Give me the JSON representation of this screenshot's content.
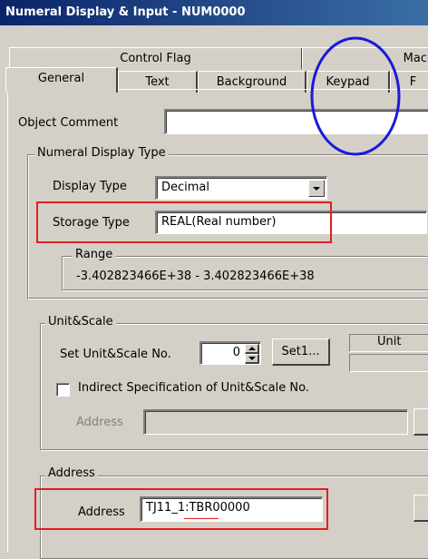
{
  "window": {
    "title": "Numeral Display & Input - NUM0000"
  },
  "tabs_back": [
    "Control Flag",
    "Mac"
  ],
  "tabs_front": [
    "General",
    "Text",
    "Background",
    "Keypad",
    "F"
  ],
  "object_comment": {
    "label": "Object Comment",
    "value": ""
  },
  "numeral_display_type": {
    "legend": "Numeral Display Type",
    "display_type_label": "Display Type",
    "display_type_value": "Decimal",
    "storage_type_label": "Storage Type",
    "storage_type_value": "REAL(Real number)",
    "range_legend": "Range",
    "range_value": "-3.402823466E+38 - 3.402823466E+38"
  },
  "unit_scale": {
    "legend": "Unit&Scale",
    "set_no_label": "Set Unit&Scale No.",
    "set_no_value": "0",
    "set_button": "Set1...",
    "unit_header": "Unit",
    "indirect_label": "Indirect Specification of Unit&Scale No.",
    "indirect_checked": false,
    "address_label": "Address",
    "address_value": ""
  },
  "address_group": {
    "legend": "Address",
    "address_label": "Address",
    "address_value": "TJ11_1:TBR00000"
  },
  "colors": {
    "highlight_box": "#e02020",
    "circle": "#1a1adc",
    "title_bar": "#0a246a"
  }
}
